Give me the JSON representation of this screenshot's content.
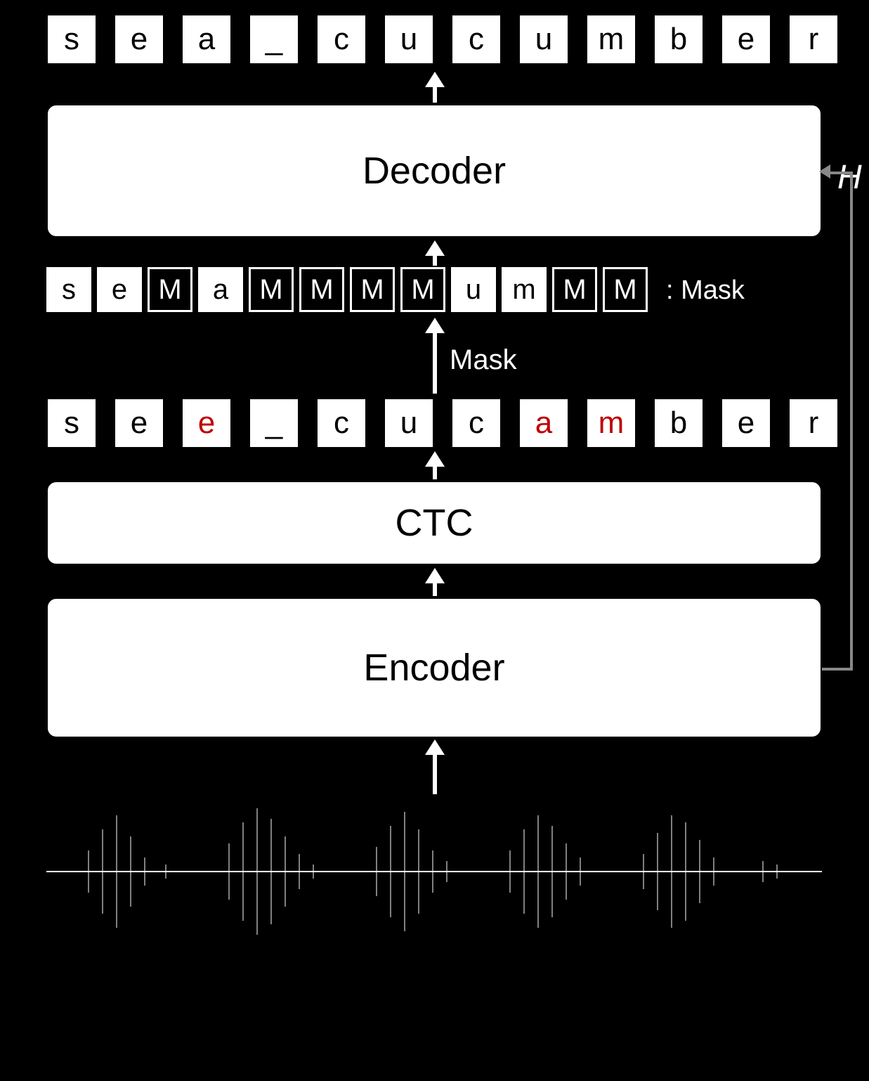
{
  "output": {
    "tokens": [
      {
        "t": "s",
        "err": false
      },
      {
        "t": "e",
        "err": false
      },
      {
        "t": "a",
        "err": false
      },
      {
        "t": "_",
        "err": false
      },
      {
        "t": "c",
        "err": false
      },
      {
        "t": "u",
        "err": false
      },
      {
        "t": "c",
        "err": false
      },
      {
        "t": "u",
        "err": false
      },
      {
        "t": "m",
        "err": false
      },
      {
        "t": "b",
        "err": false
      },
      {
        "t": "e",
        "err": false
      },
      {
        "t": "r",
        "err": false
      }
    ]
  },
  "decoder": {
    "label": "Decoder"
  },
  "masked": {
    "tokens": [
      "s",
      "e",
      "M",
      "a",
      "M",
      "M",
      "M",
      "M",
      "u",
      "m",
      "M",
      "M"
    ]
  },
  "mask_glyph": "M",
  "mask_label": "Mask",
  "ctc_out": {
    "tokens": [
      {
        "t": "s",
        "err": false
      },
      {
        "t": "e",
        "err": false
      },
      {
        "t": "e",
        "err": true
      },
      {
        "t": "_",
        "err": false
      },
      {
        "t": "c",
        "err": false
      },
      {
        "t": "u",
        "err": false
      },
      {
        "t": "c",
        "err": false
      },
      {
        "t": "a",
        "err": true
      },
      {
        "t": "m",
        "err": true
      },
      {
        "t": "b",
        "err": false
      },
      {
        "t": "e",
        "err": false
      },
      {
        "t": "r",
        "err": false
      }
    ]
  },
  "ctc": {
    "label": "CTC"
  },
  "encoder": {
    "label": "Encoder"
  },
  "h_label": "H",
  "chart_data": {
    "type": "diagram",
    "description": "Speech recognition pipeline: audio waveform → Encoder → CTC → token hypotheses (with errors in red) → random masking → Decoder (conditioned on H) → corrected output tokens",
    "input": "audio_waveform",
    "encoder_output_symbol": "H",
    "ctc_hypothesis": [
      "s",
      "e",
      "e",
      "_",
      "c",
      "u",
      "c",
      "a",
      "m",
      "b",
      "e",
      "r"
    ],
    "ctc_error_positions": [
      2,
      7,
      8
    ],
    "masked_input": [
      "s",
      "e",
      "<M>",
      "a",
      "<M>",
      "<M>",
      "<M>",
      "<M>",
      "u",
      "m",
      "<M>",
      "<M>"
    ],
    "mask_positions": [
      2,
      4,
      5,
      6,
      7,
      10,
      11
    ],
    "final_output": [
      "s",
      "e",
      "a",
      "_",
      "c",
      "u",
      "c",
      "u",
      "m",
      "b",
      "e",
      "r"
    ],
    "target_word": "sea_cucumber"
  }
}
